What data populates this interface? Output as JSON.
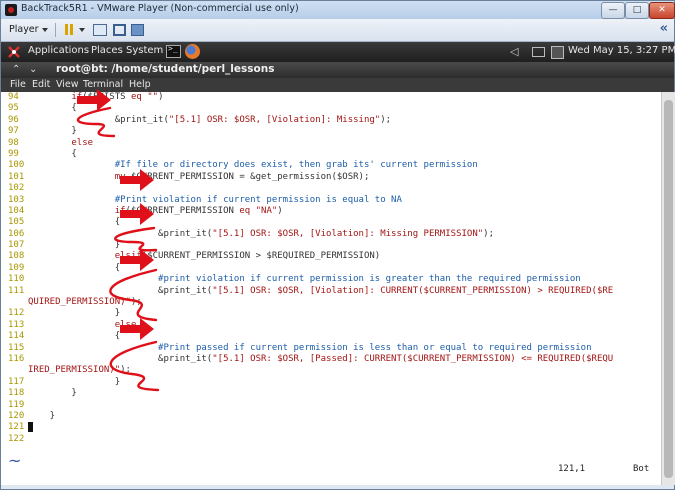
{
  "window": {
    "title": "BackTrack5R1 - VMware Player (Non-commercial use only)",
    "min_label": "—",
    "max_label": "□",
    "close_label": "✕"
  },
  "vm_toolbar": {
    "player_label": "Player",
    "collapse_label": "«"
  },
  "panel": {
    "applications": "Applications",
    "places": "Places",
    "system": "System",
    "clock": "Wed May 15,  3:27 PM"
  },
  "terminal": {
    "title": "root@bt: /home/student/perl_lessons",
    "menu": [
      "File",
      "Edit",
      "View",
      "Terminal",
      "Help"
    ],
    "status_position": "121,1",
    "status_scroll": "Bot",
    "empty_line_marker": "~"
  },
  "code_lines": [
    {
      "n": "94",
      "segs": [
        {
          "c": "pl",
          "t": "        "
        },
        {
          "c": "kw",
          "t": "if"
        },
        {
          "c": "pl",
          "t": "($EXISTS "
        },
        {
          "c": "kw",
          "t": "eq"
        },
        {
          "c": "st",
          "t": " \"\""
        },
        {
          "c": "pl",
          "t": ")"
        }
      ]
    },
    {
      "n": "95",
      "segs": [
        {
          "c": "pl",
          "t": "        {"
        }
      ]
    },
    {
      "n": "96",
      "segs": [
        {
          "c": "pl",
          "t": "                "
        },
        {
          "c": "pl",
          "t": "&print_it("
        },
        {
          "c": "st",
          "t": "\"[5.1] OSR: $OSR, [Violation]: Missing\""
        },
        {
          "c": "pl",
          "t": ");"
        }
      ]
    },
    {
      "n": "97",
      "segs": [
        {
          "c": "pl",
          "t": "        }"
        }
      ]
    },
    {
      "n": "98",
      "segs": [
        {
          "c": "pl",
          "t": "        "
        },
        {
          "c": "kw",
          "t": "else"
        }
      ]
    },
    {
      "n": "99",
      "segs": [
        {
          "c": "pl",
          "t": "        {"
        }
      ]
    },
    {
      "n": "100",
      "segs": [
        {
          "c": "pl",
          "t": "                "
        },
        {
          "c": "cm",
          "t": "#If file or directory does exist, then grab its' current permission"
        }
      ]
    },
    {
      "n": "101",
      "segs": [
        {
          "c": "pl",
          "t": "                "
        },
        {
          "c": "kw",
          "t": "my"
        },
        {
          "c": "pl",
          "t": " $CURRENT_PERMISSION = &get_permission($OSR);"
        }
      ]
    },
    {
      "n": "102",
      "segs": []
    },
    {
      "n": "103",
      "segs": [
        {
          "c": "pl",
          "t": "                "
        },
        {
          "c": "cm",
          "t": "#Print violation if current permission is equal to NA"
        }
      ]
    },
    {
      "n": "104",
      "segs": [
        {
          "c": "pl",
          "t": "                "
        },
        {
          "c": "kw",
          "t": "if"
        },
        {
          "c": "pl",
          "t": "($CURRENT_PERMISSION "
        },
        {
          "c": "kw",
          "t": "eq"
        },
        {
          "c": "st",
          "t": " \"NA\""
        },
        {
          "c": "pl",
          "t": ")"
        }
      ]
    },
    {
      "n": "105",
      "segs": [
        {
          "c": "pl",
          "t": "                {"
        }
      ]
    },
    {
      "n": "106",
      "segs": [
        {
          "c": "pl",
          "t": "                        &print_it("
        },
        {
          "c": "st",
          "t": "\"[5.1] OSR: $OSR, [Violation]: Missing PERMISSION\""
        },
        {
          "c": "pl",
          "t": ");"
        }
      ]
    },
    {
      "n": "107",
      "segs": [
        {
          "c": "pl",
          "t": "                }"
        }
      ]
    },
    {
      "n": "108",
      "segs": [
        {
          "c": "pl",
          "t": "                "
        },
        {
          "c": "kw",
          "t": "elsif"
        },
        {
          "c": "pl",
          "t": "($CURRENT_PERMISSION > $REQUIRED_PERMISSION)"
        }
      ]
    },
    {
      "n": "109",
      "segs": [
        {
          "c": "pl",
          "t": "                {"
        }
      ]
    },
    {
      "n": "110",
      "segs": [
        {
          "c": "pl",
          "t": "                        "
        },
        {
          "c": "cm",
          "t": "#print violation if current permission is greater than the required permission"
        }
      ]
    },
    {
      "n": "111",
      "segs": [
        {
          "c": "pl",
          "t": "                        &print_it("
        },
        {
          "c": "st",
          "t": "\"[5.1] OSR: $OSR, [Violation]: CURRENT($CURRENT_PERMISSION) > REQUIRED($RE"
        }
      ]
    },
    {
      "n": "",
      "segs": [
        {
          "c": "st",
          "t": "QUIRED_PERMISSION)\""
        },
        {
          "c": "pl",
          "t": ");"
        }
      ]
    },
    {
      "n": "112",
      "segs": [
        {
          "c": "pl",
          "t": "                }"
        }
      ]
    },
    {
      "n": "113",
      "segs": [
        {
          "c": "pl",
          "t": "                "
        },
        {
          "c": "kw",
          "t": "else"
        }
      ]
    },
    {
      "n": "114",
      "segs": [
        {
          "c": "pl",
          "t": "                {"
        }
      ]
    },
    {
      "n": "115",
      "segs": [
        {
          "c": "pl",
          "t": "                        "
        },
        {
          "c": "cm",
          "t": "#Print passed if current permission is less than or equal to required permission"
        }
      ]
    },
    {
      "n": "116",
      "segs": [
        {
          "c": "pl",
          "t": "                        &print_it("
        },
        {
          "c": "st",
          "t": "\"[5.1] OSR: $OSR, [Passed]: CURRENT($CURRENT_PERMISSION) <= REQUIRED($REQU"
        }
      ]
    },
    {
      "n": "",
      "segs": [
        {
          "c": "st",
          "t": "IRED_PERMISSION)\""
        },
        {
          "c": "pl",
          "t": ");"
        }
      ]
    },
    {
      "n": "117",
      "segs": [
        {
          "c": "pl",
          "t": "                }"
        }
      ]
    },
    {
      "n": "118",
      "segs": [
        {
          "c": "pl",
          "t": "        }"
        }
      ]
    },
    {
      "n": "119",
      "segs": []
    },
    {
      "n": "120",
      "segs": [
        {
          "c": "pl",
          "t": "    }"
        }
      ]
    },
    {
      "n": "121",
      "segs": [],
      "cursor": true
    },
    {
      "n": "122",
      "segs": []
    }
  ],
  "colors": {
    "annotation": "#e0101a",
    "line_number": "#a89700",
    "keyword": "#a31515",
    "comment": "#1e5ea8"
  }
}
